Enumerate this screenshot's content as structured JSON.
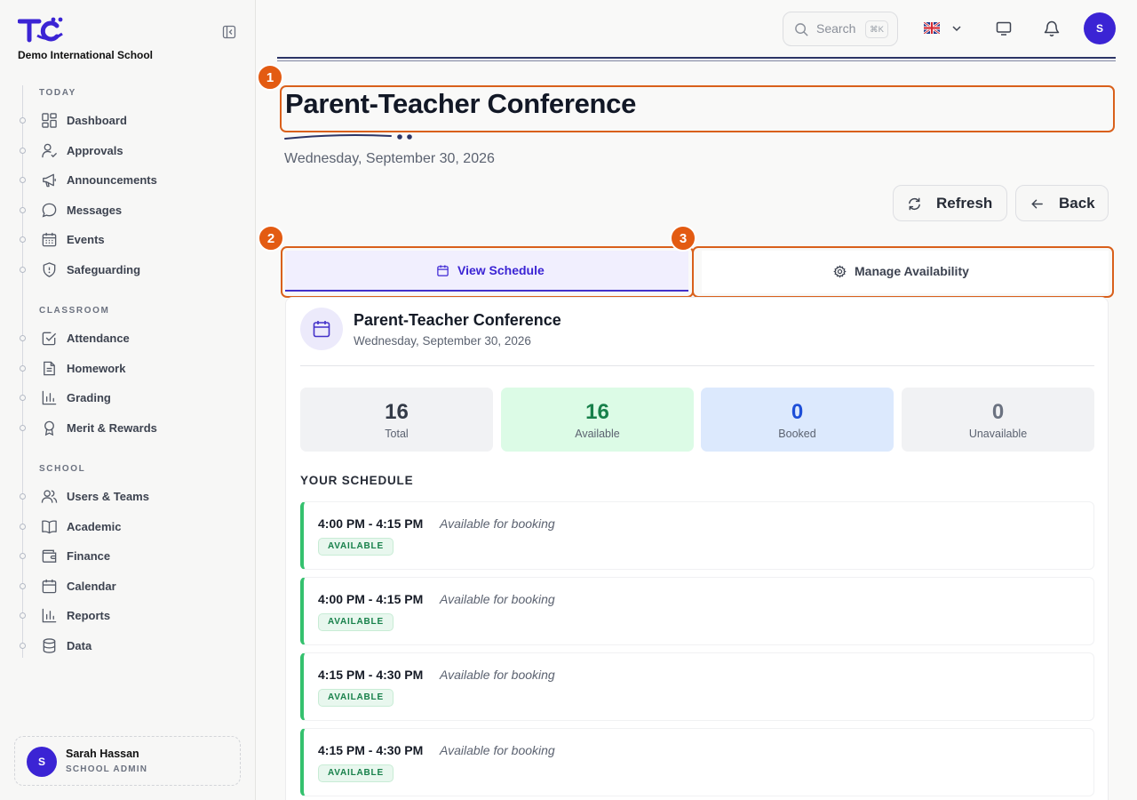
{
  "sidebar": {
    "school_name": "Demo International School",
    "sections": [
      {
        "title": "TODAY",
        "items": [
          {
            "label": "Dashboard",
            "icon": "dashboard-icon"
          },
          {
            "label": "Approvals",
            "icon": "user-check-icon"
          },
          {
            "label": "Announcements",
            "icon": "megaphone-icon"
          },
          {
            "label": "Messages",
            "icon": "chat-bubble-icon"
          },
          {
            "label": "Events",
            "icon": "calendar-icon"
          },
          {
            "label": "Safeguarding",
            "icon": "shield-icon"
          }
        ]
      },
      {
        "title": "CLASSROOM",
        "items": [
          {
            "label": "Attendance",
            "icon": "checkbox-icon"
          },
          {
            "label": "Homework",
            "icon": "document-icon"
          },
          {
            "label": "Grading",
            "icon": "bar-chart-icon"
          },
          {
            "label": "Merit & Rewards",
            "icon": "award-icon"
          }
        ]
      },
      {
        "title": "SCHOOL",
        "items": [
          {
            "label": "Users & Teams",
            "icon": "users-icon"
          },
          {
            "label": "Academic",
            "icon": "book-icon"
          },
          {
            "label": "Finance",
            "icon": "wallet-icon"
          },
          {
            "label": "Calendar",
            "icon": "calendar-icon"
          },
          {
            "label": "Reports",
            "icon": "bar-chart-icon"
          },
          {
            "label": "Data",
            "icon": "database-icon"
          }
        ]
      }
    ],
    "user": {
      "initial": "S",
      "name": "Sarah Hassan",
      "role": "SCHOOL ADMIN"
    }
  },
  "topbar": {
    "search_placeholder": "Search",
    "search_shortcut": "⌘K",
    "avatar_initial": "S"
  },
  "page": {
    "title": "Parent-Teacher Conference",
    "date": "Wednesday, September 30, 2026",
    "refresh_label": "Refresh",
    "back_label": "Back",
    "markers": [
      "1",
      "2",
      "3"
    ]
  },
  "tabs": {
    "view_schedule": "View Schedule",
    "manage_availability": "Manage Availability"
  },
  "card": {
    "title": "Parent-Teacher Conference",
    "subtitle": "Wednesday, September 30, 2026",
    "stats": [
      {
        "value": "16",
        "label": "Total"
      },
      {
        "value": "16",
        "label": "Available"
      },
      {
        "value": "0",
        "label": "Booked"
      },
      {
        "value": "0",
        "label": "Unavailable"
      }
    ],
    "schedule_heading": "YOUR SCHEDULE",
    "slots": [
      {
        "time": "4:00 PM - 4:15 PM",
        "desc": "Available for booking",
        "status": "AVAILABLE"
      },
      {
        "time": "4:00 PM - 4:15 PM",
        "desc": "Available for booking",
        "status": "AVAILABLE"
      },
      {
        "time": "4:15 PM - 4:30 PM",
        "desc": "Available for booking",
        "status": "AVAILABLE"
      },
      {
        "time": "4:15 PM - 4:30 PM",
        "desc": "Available for booking",
        "status": "AVAILABLE"
      }
    ]
  },
  "colors": {
    "brand": "#3b24d4",
    "marker": "#e35b12",
    "available": "#17804a",
    "booked": "#1d4ed8"
  }
}
